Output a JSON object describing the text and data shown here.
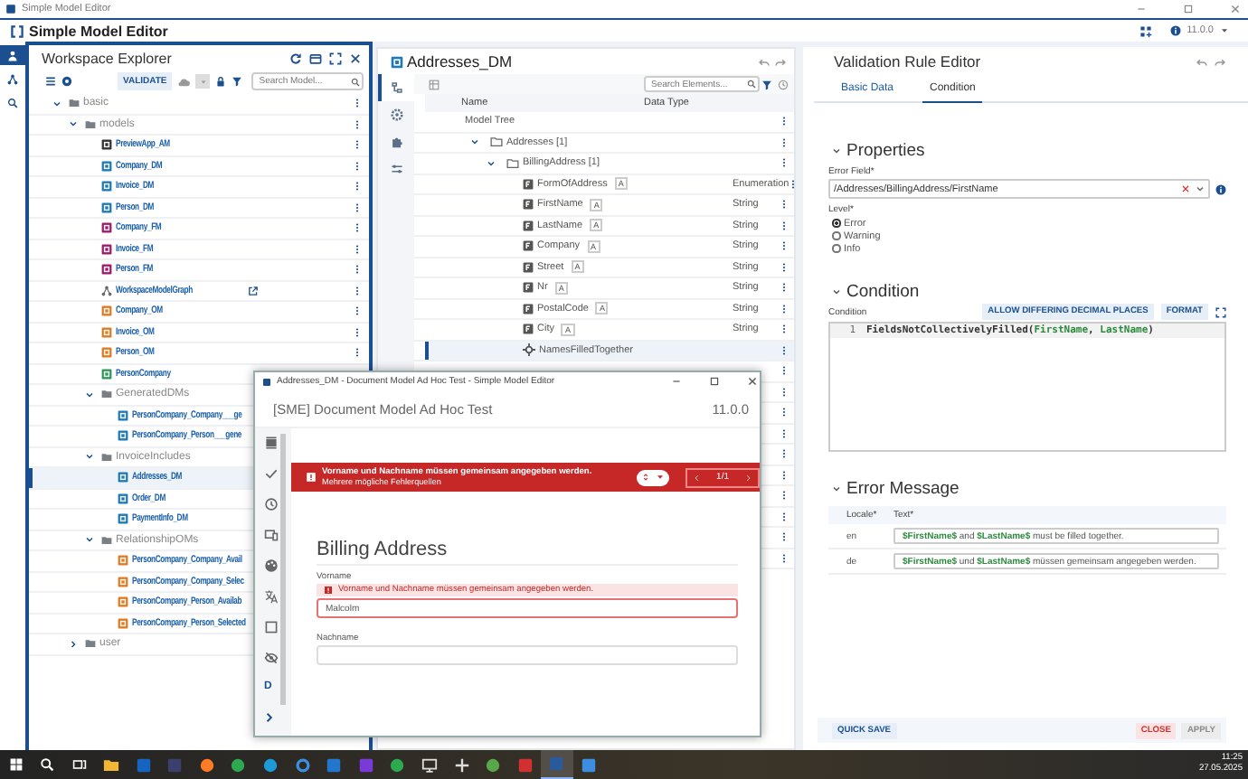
{
  "window": {
    "title": "Simple Model Editor"
  },
  "app_header": {
    "title": "Simple Model Editor",
    "version": "11.0.0"
  },
  "nav_rail": [
    {
      "kind": "models",
      "selected": true
    },
    {
      "kind": "graph",
      "selected": false
    },
    {
      "kind": "search",
      "selected": false
    }
  ],
  "workspace_explorer": {
    "title": "Workspace Explorer",
    "validate_button": "VALIDATE",
    "search": {
      "placeholder": "Search Model..."
    },
    "tree": [
      {
        "label": "basic",
        "kind": "folder",
        "expanded": true,
        "selected": false,
        "menu": true,
        "children": [
          {
            "label": "models",
            "kind": "folder",
            "expanded": true,
            "selected": false,
            "menu": true,
            "children": [
              {
                "label": "PreviewApp_AM",
                "kind": "app",
                "selected": false,
                "menu": true
              },
              {
                "label": "Company_DM",
                "kind": "dm",
                "selected": false,
                "menu": true
              },
              {
                "label": "Invoice_DM",
                "kind": "dm",
                "selected": false,
                "menu": true
              },
              {
                "label": "Person_DM",
                "kind": "dm",
                "selected": false,
                "menu": true
              },
              {
                "label": "Company_FM",
                "kind": "fm",
                "selected": false,
                "menu": true
              },
              {
                "label": "Invoice_FM",
                "kind": "fm",
                "selected": false,
                "menu": true
              },
              {
                "label": "Person_FM",
                "kind": "fm",
                "selected": false,
                "menu": true
              },
              {
                "label": "WorkspaceModelGraph",
                "kind": "graph",
                "selected": false,
                "menu": true
              },
              {
                "label": "Company_OM",
                "kind": "om",
                "selected": false,
                "menu": true
              },
              {
                "label": "Invoice_OM",
                "kind": "om",
                "selected": false,
                "menu": true
              },
              {
                "label": "Person_OM",
                "kind": "om",
                "selected": false,
                "menu": true
              },
              {
                "label": "PersonCompany",
                "kind": "pc",
                "selected": false,
                "menu": false
              },
              {
                "label": "GeneratedDMs",
                "kind": "folder",
                "expanded": true,
                "selected": false,
                "menu": false,
                "children": [
                  {
                    "label": "PersonCompany_Company___ge",
                    "kind": "dm",
                    "selected": false,
                    "menu": false
                  },
                  {
                    "label": "PersonCompany_Person___gene",
                    "kind": "dm",
                    "selected": false,
                    "menu": false
                  }
                ]
              },
              {
                "label": "InvoiceIncludes",
                "kind": "folder",
                "expanded": true,
                "selected": false,
                "menu": false,
                "children": [
                  {
                    "label": "Addresses_DM",
                    "kind": "dm",
                    "selected": true,
                    "menu": false
                  },
                  {
                    "label": "Order_DM",
                    "kind": "dm",
                    "selected": false,
                    "menu": false
                  },
                  {
                    "label": "PaymentInfo_DM",
                    "kind": "dm",
                    "selected": false,
                    "menu": false
                  }
                ]
              },
              {
                "label": "RelationshipOMs",
                "kind": "folder",
                "expanded": true,
                "selected": false,
                "menu": false,
                "children": [
                  {
                    "label": "PersonCompany_Company_Avail",
                    "kind": "rel",
                    "selected": false,
                    "menu": false
                  },
                  {
                    "label": "PersonCompany_Company_Selec",
                    "kind": "rel",
                    "selected": false,
                    "menu": false
                  },
                  {
                    "label": "PersonCompany_Person_Availab",
                    "kind": "rel",
                    "selected": false,
                    "menu": false
                  },
                  {
                    "label": "PersonCompany_Person_Selected",
                    "kind": "rel",
                    "selected": false,
                    "menu": false
                  }
                ]
              }
            ]
          },
          {
            "label": "user",
            "kind": "folder",
            "expanded": false,
            "selected": false,
            "menu": false
          }
        ]
      }
    ]
  },
  "model_panel": {
    "title": "Addresses_DM",
    "rail": [
      {
        "kind": "structure",
        "selected": true
      },
      {
        "kind": "settings",
        "selected": false
      },
      {
        "kind": "plugin",
        "selected": false
      },
      {
        "kind": "sliders",
        "selected": false
      }
    ],
    "search": {
      "placeholder": "Search Elements..."
    },
    "columns": [
      "Name",
      "Data Type"
    ],
    "tree": [
      {
        "name": "Model Tree",
        "kind": "root",
        "selected": false,
        "children": [
          {
            "name": "Addresses [1]",
            "kind": "group",
            "expanded": true,
            "selected": false,
            "children": [
              {
                "name": "BillingAddress [1]",
                "kind": "group",
                "expanded": true,
                "selected": false,
                "children": [
                  {
                    "name": "FormOfAddress",
                    "kind": "field",
                    "badge": "A",
                    "data_type": "Enumeration",
                    "selected": false
                  },
                  {
                    "name": "FirstName",
                    "kind": "field",
                    "badge": "A",
                    "data_type": "String",
                    "selected": false
                  },
                  {
                    "name": "LastName",
                    "kind": "field",
                    "badge": "A",
                    "data_type": "String",
                    "selected": false
                  },
                  {
                    "name": "Company",
                    "kind": "field",
                    "badge": "A",
                    "data_type": "String",
                    "selected": false
                  },
                  {
                    "name": "Street",
                    "kind": "field",
                    "badge": "A",
                    "data_type": "String",
                    "selected": false
                  },
                  {
                    "name": "Nr",
                    "kind": "field",
                    "badge": "A",
                    "data_type": "String",
                    "selected": false
                  },
                  {
                    "name": "PostalCode",
                    "kind": "field",
                    "badge": "A",
                    "data_type": "String",
                    "selected": false
                  },
                  {
                    "name": "City",
                    "kind": "field",
                    "badge": "A",
                    "data_type": "String",
                    "selected": false
                  },
                  {
                    "name": "NamesFilledTogether",
                    "kind": "rule",
                    "selected": true
                  }
                ]
              }
            ]
          }
        ]
      }
    ],
    "covered_rows": [
      {
        "kind": "menu"
      },
      {
        "kind": "menu"
      },
      {
        "kind": "menu"
      },
      {
        "kind": "menu"
      },
      {
        "kind": "menu"
      },
      {
        "kind": "menu"
      },
      {
        "kind": "menu"
      },
      {
        "kind": "menu"
      },
      {
        "kind": "menu"
      },
      {
        "kind": "menu"
      }
    ]
  },
  "rule_editor": {
    "title": "Validation Rule Editor",
    "tabs": [
      {
        "label": "Basic Data",
        "selected": false
      },
      {
        "label": "Condition",
        "selected": true
      }
    ],
    "properties": {
      "heading": "Properties",
      "error_field": {
        "label": "Error Field*",
        "value": "/Addresses/BillingAddress/FirstName"
      },
      "level": {
        "label": "Level*",
        "options": [
          {
            "label": "Error",
            "selected": true
          },
          {
            "label": "Warning",
            "selected": false
          },
          {
            "label": "Info",
            "selected": false
          }
        ]
      }
    },
    "condition": {
      "heading": "Condition",
      "label": "Condition",
      "buttons": [
        "ALLOW DIFFERING DECIMAL PLACES",
        "FORMAT"
      ],
      "code": [
        {
          "number": "1",
          "tokens": [
            {
              "text": "FieldsNotCollectivelyFilled(",
              "kind": "plain"
            },
            {
              "text": "FirstName",
              "kind": "field"
            },
            {
              "text": ", ",
              "kind": "plain"
            },
            {
              "text": "LastName",
              "kind": "field"
            },
            {
              "text": ")",
              "kind": "plain"
            }
          ]
        }
      ]
    },
    "error_message": {
      "heading": "Error Message",
      "columns": [
        "Locale*",
        "Text*"
      ],
      "rows": [
        {
          "locale": "en",
          "text": "**$FirstName$** and **$LastName$** must be filled together."
        },
        {
          "locale": "de",
          "text": "**$FirstName$** und **$LastName$** müssen gemeinsam angegeben werden."
        }
      ]
    },
    "footer": {
      "quick_save": "QUICK SAVE",
      "close": "CLOSE",
      "apply": {
        "label": "APPLY",
        "disabled": true
      }
    }
  },
  "dialog": {
    "title": "Addresses_DM - Document Model Ad Hoc Test - Simple Model Editor",
    "heading": "[SME] Document Model Ad Hoc Test",
    "version": "11.0.0",
    "rail": [
      {
        "kind": "layers"
      },
      {
        "kind": "check"
      },
      {
        "kind": "history"
      },
      {
        "kind": "devices"
      },
      {
        "kind": "palette"
      },
      {
        "kind": "translate"
      },
      {
        "kind": "square"
      },
      {
        "kind": "eyeoff"
      },
      {
        "kind": "letter",
        "label": "D"
      }
    ],
    "banner": {
      "message": "Vorname und Nachname müssen gemeinsam angegeben werden.",
      "detail": "Mehrere mögliche Fehlerquellen",
      "pager": "1/1"
    },
    "form": {
      "heading": "Billing Address",
      "fields": [
        {
          "label": "Vorname",
          "error": "Vorname und Nachname müssen gemeinsam angegeben werden.",
          "value": "Malcolm",
          "invalid": true
        },
        {
          "label": "Nachname",
          "invalid": false
        }
      ]
    }
  },
  "taskbar": {
    "apps": [
      {
        "kind": "folder",
        "selected": false
      },
      {
        "kind": "mail",
        "selected": false
      },
      {
        "kind": "chat",
        "selected": false
      },
      {
        "kind": "fox",
        "selected": false
      },
      {
        "kind": "globe",
        "selected": false
      },
      {
        "kind": "edge",
        "selected": false
      },
      {
        "kind": "ie",
        "selected": false
      },
      {
        "kind": "code",
        "selected": false
      },
      {
        "kind": "ide",
        "selected": false
      },
      {
        "kind": "globe",
        "selected": false
      },
      {
        "kind": "monitor",
        "selected": false
      },
      {
        "kind": "plus",
        "selected": false
      },
      {
        "kind": "green",
        "selected": false
      },
      {
        "kind": "red",
        "selected": false
      },
      {
        "kind": "sme",
        "selected": true
      },
      {
        "kind": "blue",
        "selected": false
      }
    ],
    "time": "11:25",
    "date": "27.05.2025"
  }
}
